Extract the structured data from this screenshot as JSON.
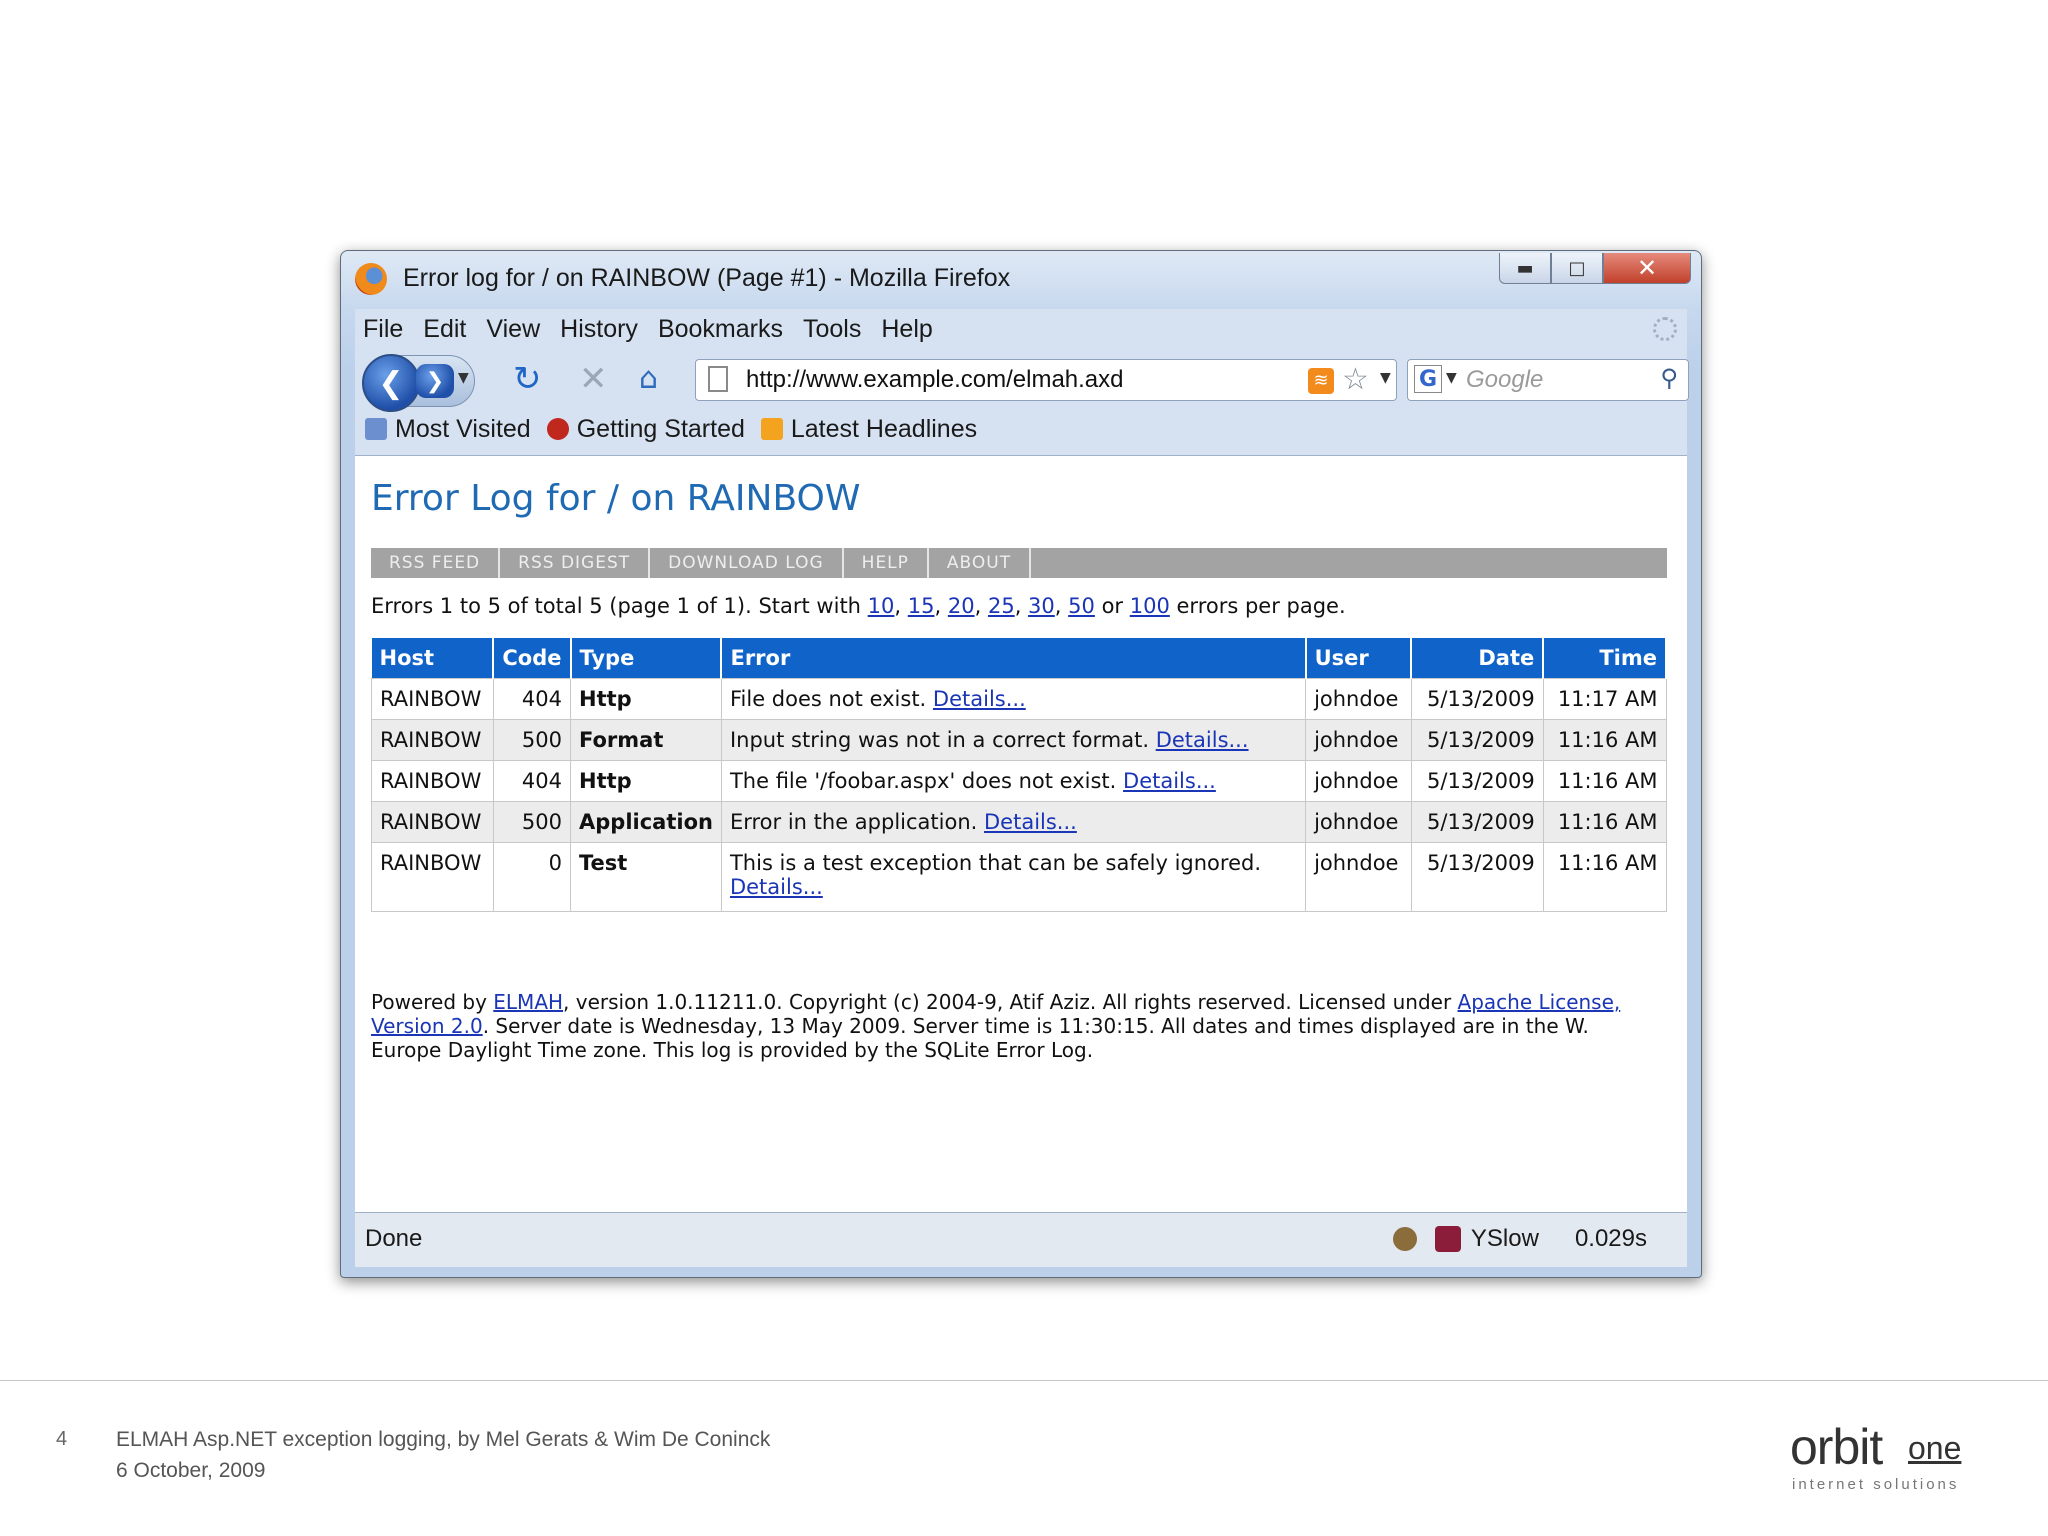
{
  "window": {
    "title": "Error log for / on RAINBOW (Page #1) - Mozilla Firefox",
    "menu": [
      "File",
      "Edit",
      "View",
      "History",
      "Bookmarks",
      "Tools",
      "Help"
    ],
    "url": "http://www.example.com/elmah.axd",
    "search_placeholder": "Google",
    "bookmarks": [
      "Most Visited",
      "Getting Started",
      "Latest Headlines"
    ],
    "status": "Done",
    "yslow_label": "YSlow",
    "yslow_time": "0.029s"
  },
  "page": {
    "title": "Error Log for / on RAINBOW",
    "speedbar": [
      "RSS FEED",
      "RSS DIGEST",
      "DOWNLOAD LOG",
      "HELP",
      "ABOUT"
    ],
    "paging": {
      "prefix": "Errors 1 to 5 of total 5 (page 1 of 1). Start with",
      "sizes": [
        "10",
        "15",
        "20",
        "25",
        "30",
        "50",
        "100"
      ],
      "or": "or",
      "suffix": "errors per page."
    },
    "columns": [
      "Host",
      "Code",
      "Type",
      "Error",
      "User",
      "Date",
      "Time"
    ],
    "details_label": "Details...",
    "rows": [
      {
        "host": "RAINBOW",
        "code": "404",
        "type": "Http",
        "error": "File does not exist.",
        "user": "johndoe",
        "date": "5/13/2009",
        "time": "11:17 AM"
      },
      {
        "host": "RAINBOW",
        "code": "500",
        "type": "Format",
        "error": "Input string was not in a correct format.",
        "user": "johndoe",
        "date": "5/13/2009",
        "time": "11:16 AM"
      },
      {
        "host": "RAINBOW",
        "code": "404",
        "type": "Http",
        "error": "The file '/foobar.aspx' does not exist.",
        "user": "johndoe",
        "date": "5/13/2009",
        "time": "11:16 AM"
      },
      {
        "host": "RAINBOW",
        "code": "500",
        "type": "Application",
        "error": "Error in the application.",
        "user": "johndoe",
        "date": "5/13/2009",
        "time": "11:16 AM"
      },
      {
        "host": "RAINBOW",
        "code": "0",
        "type": "Test",
        "error": "This is a test exception that can be safely ignored.",
        "user": "johndoe",
        "date": "5/13/2009",
        "time": "11:16 AM"
      }
    ],
    "footer": {
      "p1": "Powered by",
      "elmah_link": "ELMAH",
      "p2": ", version 1.0.11211.0. Copyright (c) 2004-9, Atif Aziz. All rights reserved. Licensed under",
      "license_link": "Apache License, Version 2.0",
      "p3": ". Server date is Wednesday, 13 May 2009. Server time is 11:30:15. All dates and times displayed are in the W. Europe Daylight Time zone. This log is provided by the SQLite Error Log."
    }
  },
  "slide": {
    "number": "4",
    "caption_line1": "ELMAH Asp.NET exception logging, by Mel Gerats & Wim De Coninck",
    "caption_line2": "6 October, 2009",
    "logo_main": "orbit",
    "logo_one": "one",
    "logo_sub": "internet solutions"
  },
  "colors": {
    "header_blue": "#0f63c9",
    "title_blue": "#1f6ab3",
    "link_blue": "#1a35b5",
    "speedbar_gray": "#a3a3a3"
  }
}
